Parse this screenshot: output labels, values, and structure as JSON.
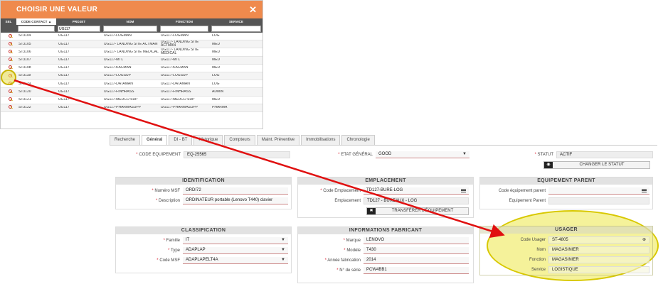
{
  "picker": {
    "title": "CHOISIR UNE VALEUR",
    "close_glyph": "✕",
    "columns": [
      "SEL",
      "CODE CONTACT ▲",
      "PROJET",
      "NOM",
      "FONCTION",
      "SERVICE"
    ],
    "filter_value": "UG117",
    "rows": [
      {
        "code": "ST3104",
        "projet": "UG117",
        "nom": "UG117-LOGMAN",
        "fonction": "UG117-LOGMAN",
        "service": "LOG"
      },
      {
        "code": "ST3105",
        "projet": "UG117",
        "nom": "UG117- LANDING SITE ACTMAN",
        "fonction": "UG117- LANDING SITE ACTMAN",
        "service": "MED"
      },
      {
        "code": "ST3106",
        "projet": "UG117",
        "nom": "UG117- LANDING SITE MEDICAL",
        "fonction": "UG117- LANDING SITE MEDICAL",
        "service": "MED"
      },
      {
        "code": "ST3107",
        "projet": "UG117",
        "nom": "UG117-MTL",
        "fonction": "UG117-MTL",
        "service": "MED"
      },
      {
        "code": "ST3108",
        "projet": "UG117",
        "nom": "UG117-KACMAN",
        "fonction": "UG117-KACMAN",
        "service": "MED"
      },
      {
        "code": "ST3118",
        "projet": "UG117",
        "nom": "UG117-LOGSUP",
        "fonction": "UG117-LOGSUP",
        "service": "LOG"
      },
      {
        "code": "ST3119",
        "projet": "UG117",
        "nom": "UG117-DATAMAN",
        "fonction": "UG117-DATAMAN",
        "service": "LOG"
      },
      {
        "code": "ST3120",
        "projet": "UG117",
        "nom": "UG117-FINHRASS",
        "fonction": "UG117-FINHRASS",
        "service": "ADMIN"
      },
      {
        "code": "ST3121",
        "projet": "UG117",
        "nom": "UG117-MEDCO SUP",
        "fonction": "UG117-MEDCO SUP",
        "service": "MED"
      },
      {
        "code": "ST3122",
        "projet": "UG117",
        "nom": "UG117-PHARMASUPP",
        "fonction": "UG117-PHARMASUPP",
        "service": "PHARMA"
      }
    ]
  },
  "tabs": [
    "Recherche",
    "Général",
    "DI - BT",
    "Historique",
    "Compteurs",
    "Maint. Préventive",
    "Immobilisations",
    "Chronologie"
  ],
  "header": {
    "code_equipement_label": "CODE EQUIPEMENT",
    "code_equipement_value": "EQ-25565",
    "etat_label": "ETAT GÉNÉRAL",
    "etat_value": "GOOD",
    "statut_label": "STATUT",
    "statut_value": "ACTIF",
    "changer_statut": "CHANGER LE STATUT"
  },
  "identification": {
    "title": "IDENTIFICATION",
    "numero_label": "Numéro MSF",
    "numero_value": "ORDI72",
    "description_label": "Description",
    "description_value": "ORDINATEUR portable (Lenovo T440) clavier"
  },
  "emplacement": {
    "title": "EMPLACEMENT",
    "code_label": "Code Emplacement",
    "code_value": "TD127-BURE-LOG",
    "empl_label": "Emplacement",
    "empl_value": "TD127 - BUREAUX - LOG",
    "transferer": "TRANSFÉRER L'ÉQUIPEMENT"
  },
  "parent": {
    "title": "EQUIPEMENT PARENT",
    "code_label": "Code équipement parent",
    "parent_label": "Equipement Parent"
  },
  "classification": {
    "title": "CLASSIFICATION",
    "famille_label": "Famille",
    "famille_value": "IT",
    "type_label": "Type",
    "type_value": "ADAPLAP",
    "codemsf_label": "Code MSF",
    "codemsf_value": "ADAPLAPELT4A"
  },
  "fabricant": {
    "title": "INFORMATIONS FABRICANT",
    "marque_label": "Marque",
    "marque_value": "LENOVO",
    "modele_label": "Modèle",
    "modele_value": "T430",
    "annee_label": "Année fabrication",
    "annee_value": "2014",
    "serie_label": "N° de série",
    "serie_value": "PCW4BB1"
  },
  "usager": {
    "title": "USAGER",
    "code_label": "Code Usager",
    "code_value": "ST-4805",
    "nom_label": "Nom",
    "nom_value": "MAGASINIER",
    "fonction_label": "Fonction",
    "fonction_value": "MAGASINIER",
    "service_label": "Service",
    "service_value": "LOGISTIQUE"
  },
  "colors": {
    "accent": "#ef8a4d",
    "arrow": "#e01010",
    "highlight": "#ebe150"
  }
}
